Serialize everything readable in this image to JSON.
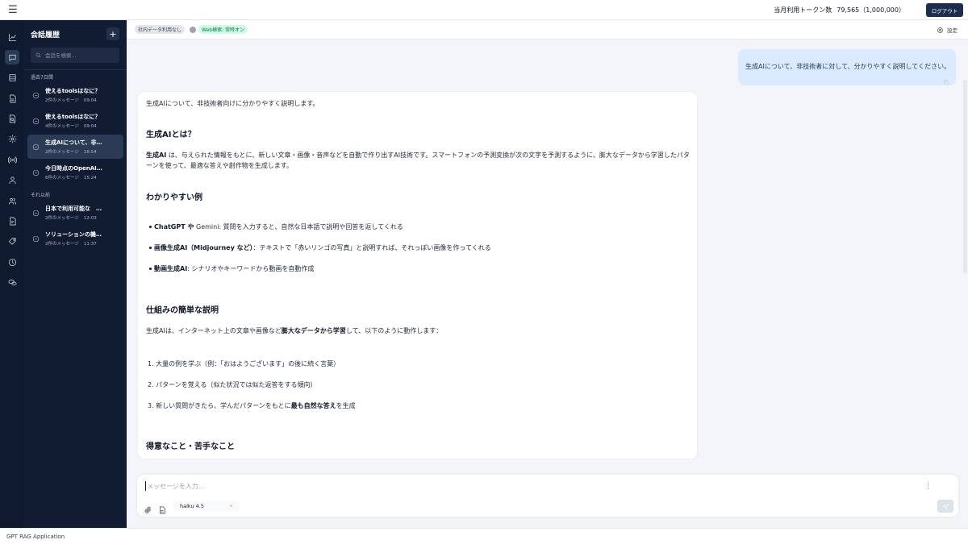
{
  "header": {
    "token_label": "当月利用トークン数",
    "token_value": "79,565（1,000,000）",
    "logout_label": "ログアウト"
  },
  "history": {
    "title": "会話履歴",
    "new_chat_label": "+",
    "search_placeholder": "会話を検索...",
    "sections": [
      {
        "label": "過去7日間",
        "items": [
          {
            "title": "使えるtoolsはなに？",
            "count": "2件のメッセージ",
            "time": "09:04"
          },
          {
            "title": "使えるtoolsはなに？",
            "count": "4件のメッセージ",
            "time": "09:04"
          },
          {
            "title": "生成AIについて、非…",
            "count": "2件のメッセージ",
            "time": "16:54"
          },
          {
            "title": "今日時点のOpenAI…",
            "count": "6件のメッセージ",
            "time": "15:24"
          }
        ]
      },
      {
        "label": "それ以前",
        "items": [
          {
            "title": "日本で利用可能な　…",
            "count": "2件のメッセージ",
            "time": "12:03"
          },
          {
            "title": "ソリューションの機…",
            "count": "2件のメッセージ",
            "time": "11:37"
          }
        ]
      }
    ]
  },
  "status": {
    "chip_internal": "社内データ利用なし",
    "chip_web": "Web検索: 常時オン",
    "settings_label": "設定"
  },
  "chat": {
    "user_message": "生成AIについて、非技術者に対して、分かりやすく説明してください。",
    "assistant": {
      "intro": "生成AIについて、非技術者向けに分かりやすく説明します。",
      "h1": "生成AIとは？",
      "p1_bold": "生成AI",
      "p1_line1": " は、与えられた情報をもとに、新しい文章・画像・音声などを自動で作り出すAI技術です。スマートフォンの予測変換が次の文字を予測するように、膨大なデータから学習したパタ",
      "p1_line2": "ーンを使って、最適な答えや創作物を生成します。",
      "h2": "わかりやすい例",
      "b1_bold": "ChatGPT や",
      "b1_rest": " Gemini: 質問を入力すると、自然な日本語で説明や回答を返してくれる",
      "b2_bold": "画像生成AI（Midjourney など）",
      "b2_rest": "：テキストで「赤いリンゴの写真」と説明すれば、それっぽい画像を作ってくれる",
      "b3_bold": "動画生成AI",
      "b3_rest": ": シナリオやキーワードから動画を自動作成",
      "h3": "仕組みの簡単な説明",
      "p2_start": "生成AIは、インターネット上の文章や画像など",
      "p2_bold": "膨大なデータから学習",
      "p2_end": "して、以下のように動作します：",
      "o1": "1. 大量の例を学ぶ（例：「おはようございます」の後に続く言葉）",
      "o2": "2. パターンを覚える（似た状況では似た返答をする傾向）",
      "o3_start": "3. 新しい質問がきたら、学んだパターンをもとに",
      "o3_bold": "最も自然な答え",
      "o3_end": "を生成",
      "h4": "得意なこと・苦手なこと"
    }
  },
  "composer": {
    "placeholder": "メッセージを入力...",
    "more_label": "⋮",
    "model": "haiku 4.5"
  },
  "footer": {
    "app_name": "GPT RAG Application"
  }
}
